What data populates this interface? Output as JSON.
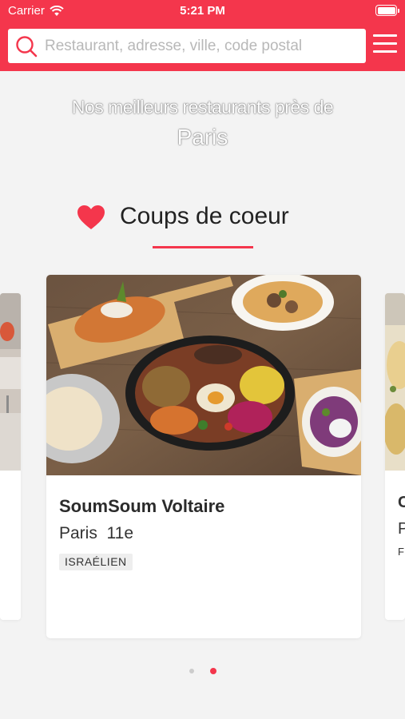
{
  "status_bar": {
    "carrier": "Carrier",
    "time": "5:21 PM",
    "battery_level": 1.0
  },
  "search": {
    "placeholder": "Restaurant, adresse, ville, code postal",
    "value": ""
  },
  "hero": {
    "headline": "Nos meilleurs restaurants près de",
    "city": "Paris"
  },
  "section": {
    "title": "Coups de coeur",
    "icon": "heart-icon"
  },
  "featured_card": {
    "name": "SoumSoum Voltaire",
    "location": "Paris  11e",
    "tag": "ISRAÉLIEN"
  },
  "carousel": {
    "page_count": 2,
    "active_index": 1
  },
  "colors": {
    "brand": "#f4364c",
    "background": "#f3f3f3",
    "text": "#222222",
    "tag_bg": "#eeeeee"
  }
}
